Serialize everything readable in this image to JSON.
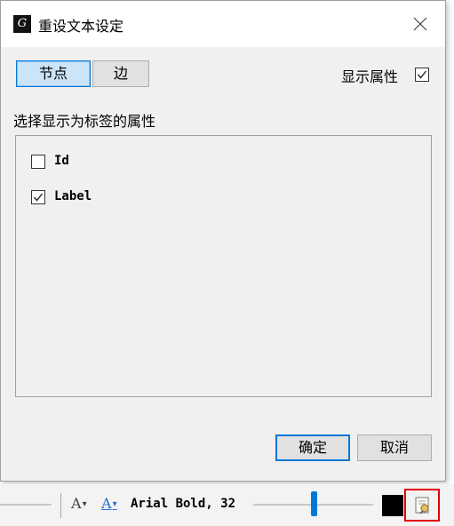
{
  "dialog": {
    "title": "重设文本设定",
    "tabs": [
      {
        "label": "节点",
        "selected": true
      },
      {
        "label": "边",
        "selected": false
      }
    ],
    "show_attributes": {
      "label": "显示属性",
      "checked": true
    },
    "section_label": "选择显示为标签的属性",
    "attributes": [
      {
        "label": "Id",
        "checked": false
      },
      {
        "label": "Label",
        "checked": true
      }
    ],
    "buttons": {
      "ok": "确定",
      "cancel": "取消"
    }
  },
  "toolbar": {
    "font_size_icon_text": "A",
    "font_color_icon_text": "A",
    "font_name": "Arial Bold, 32",
    "text_color": "#000000"
  },
  "colors": {
    "accent": "#0078d7",
    "highlight": "#e00000"
  }
}
